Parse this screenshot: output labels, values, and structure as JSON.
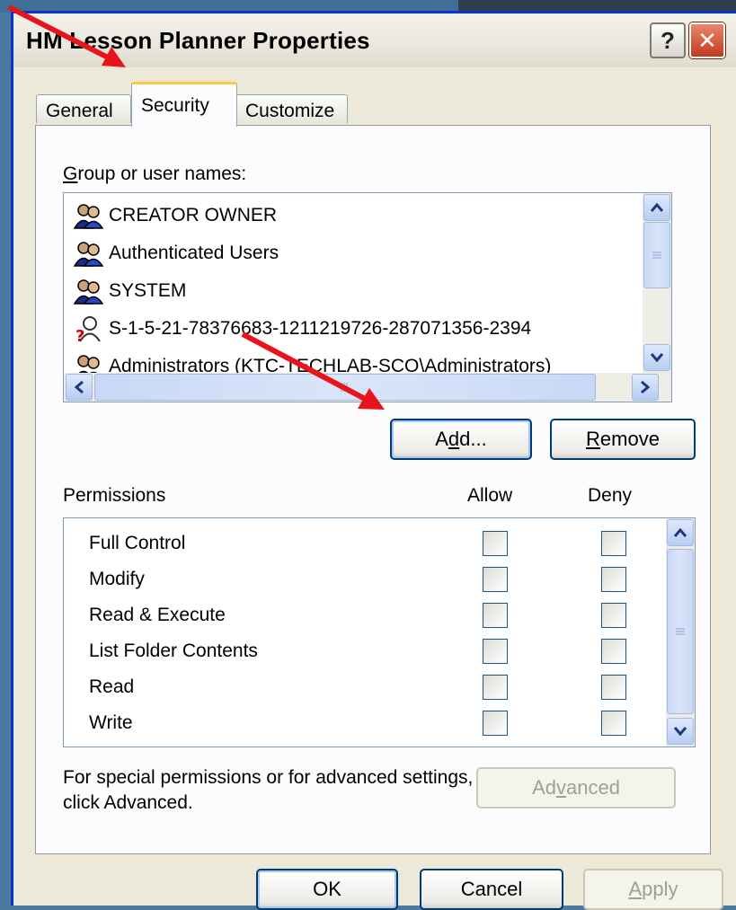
{
  "dialog": {
    "title": "HM Lesson Planner Properties",
    "help_glyph": "?",
    "close_glyph": "✕"
  },
  "tabs": [
    {
      "label": "General",
      "active": false
    },
    {
      "label": "Security",
      "active": true
    },
    {
      "label": "Customize",
      "active": false
    }
  ],
  "users_section": {
    "label_prefix": "G",
    "label_rest": "roup or user names:",
    "items": [
      {
        "name": "CREATOR OWNER",
        "icon": "group-icon"
      },
      {
        "name": "Authenticated Users",
        "icon": "group-icon"
      },
      {
        "name": "SYSTEM",
        "icon": "group-icon"
      },
      {
        "name": "S-1-5-21-78376683-1211219726-287071356-2394",
        "icon": "unknown-user-icon"
      },
      {
        "name": "Administrators (KTC-TECHLAB-SCO\\Administrators)",
        "icon": "group-icon"
      }
    ]
  },
  "buttons": {
    "add_a": "A",
    "add_d": "d",
    "add_rest": "d...",
    "remove_r": "R",
    "remove_rest": "emove",
    "advanced_pre": "Ad",
    "advanced_v": "v",
    "advanced_post": "anced",
    "ok": "OK",
    "cancel": "Cancel",
    "apply_a": "A",
    "apply_rest": "pply"
  },
  "permissions": {
    "header_label": "Permissions",
    "allow_label": "Allow",
    "deny_label": "Deny",
    "rows": [
      {
        "label": "Full Control",
        "allow": false,
        "deny": false
      },
      {
        "label": "Modify",
        "allow": false,
        "deny": false
      },
      {
        "label": "Read & Execute",
        "allow": false,
        "deny": false
      },
      {
        "label": "List Folder Contents",
        "allow": false,
        "deny": false
      },
      {
        "label": "Read",
        "allow": false,
        "deny": false
      },
      {
        "label": "Write",
        "allow": false,
        "deny": false
      }
    ]
  },
  "advanced_note_line1": "For special permissions or for advanced settings,",
  "advanced_note_line2": "click Advanced.",
  "colors": {
    "annotation_arrow": "#e8141b",
    "tab_highlight": "#ffc73c",
    "button_border": "#003c74"
  }
}
